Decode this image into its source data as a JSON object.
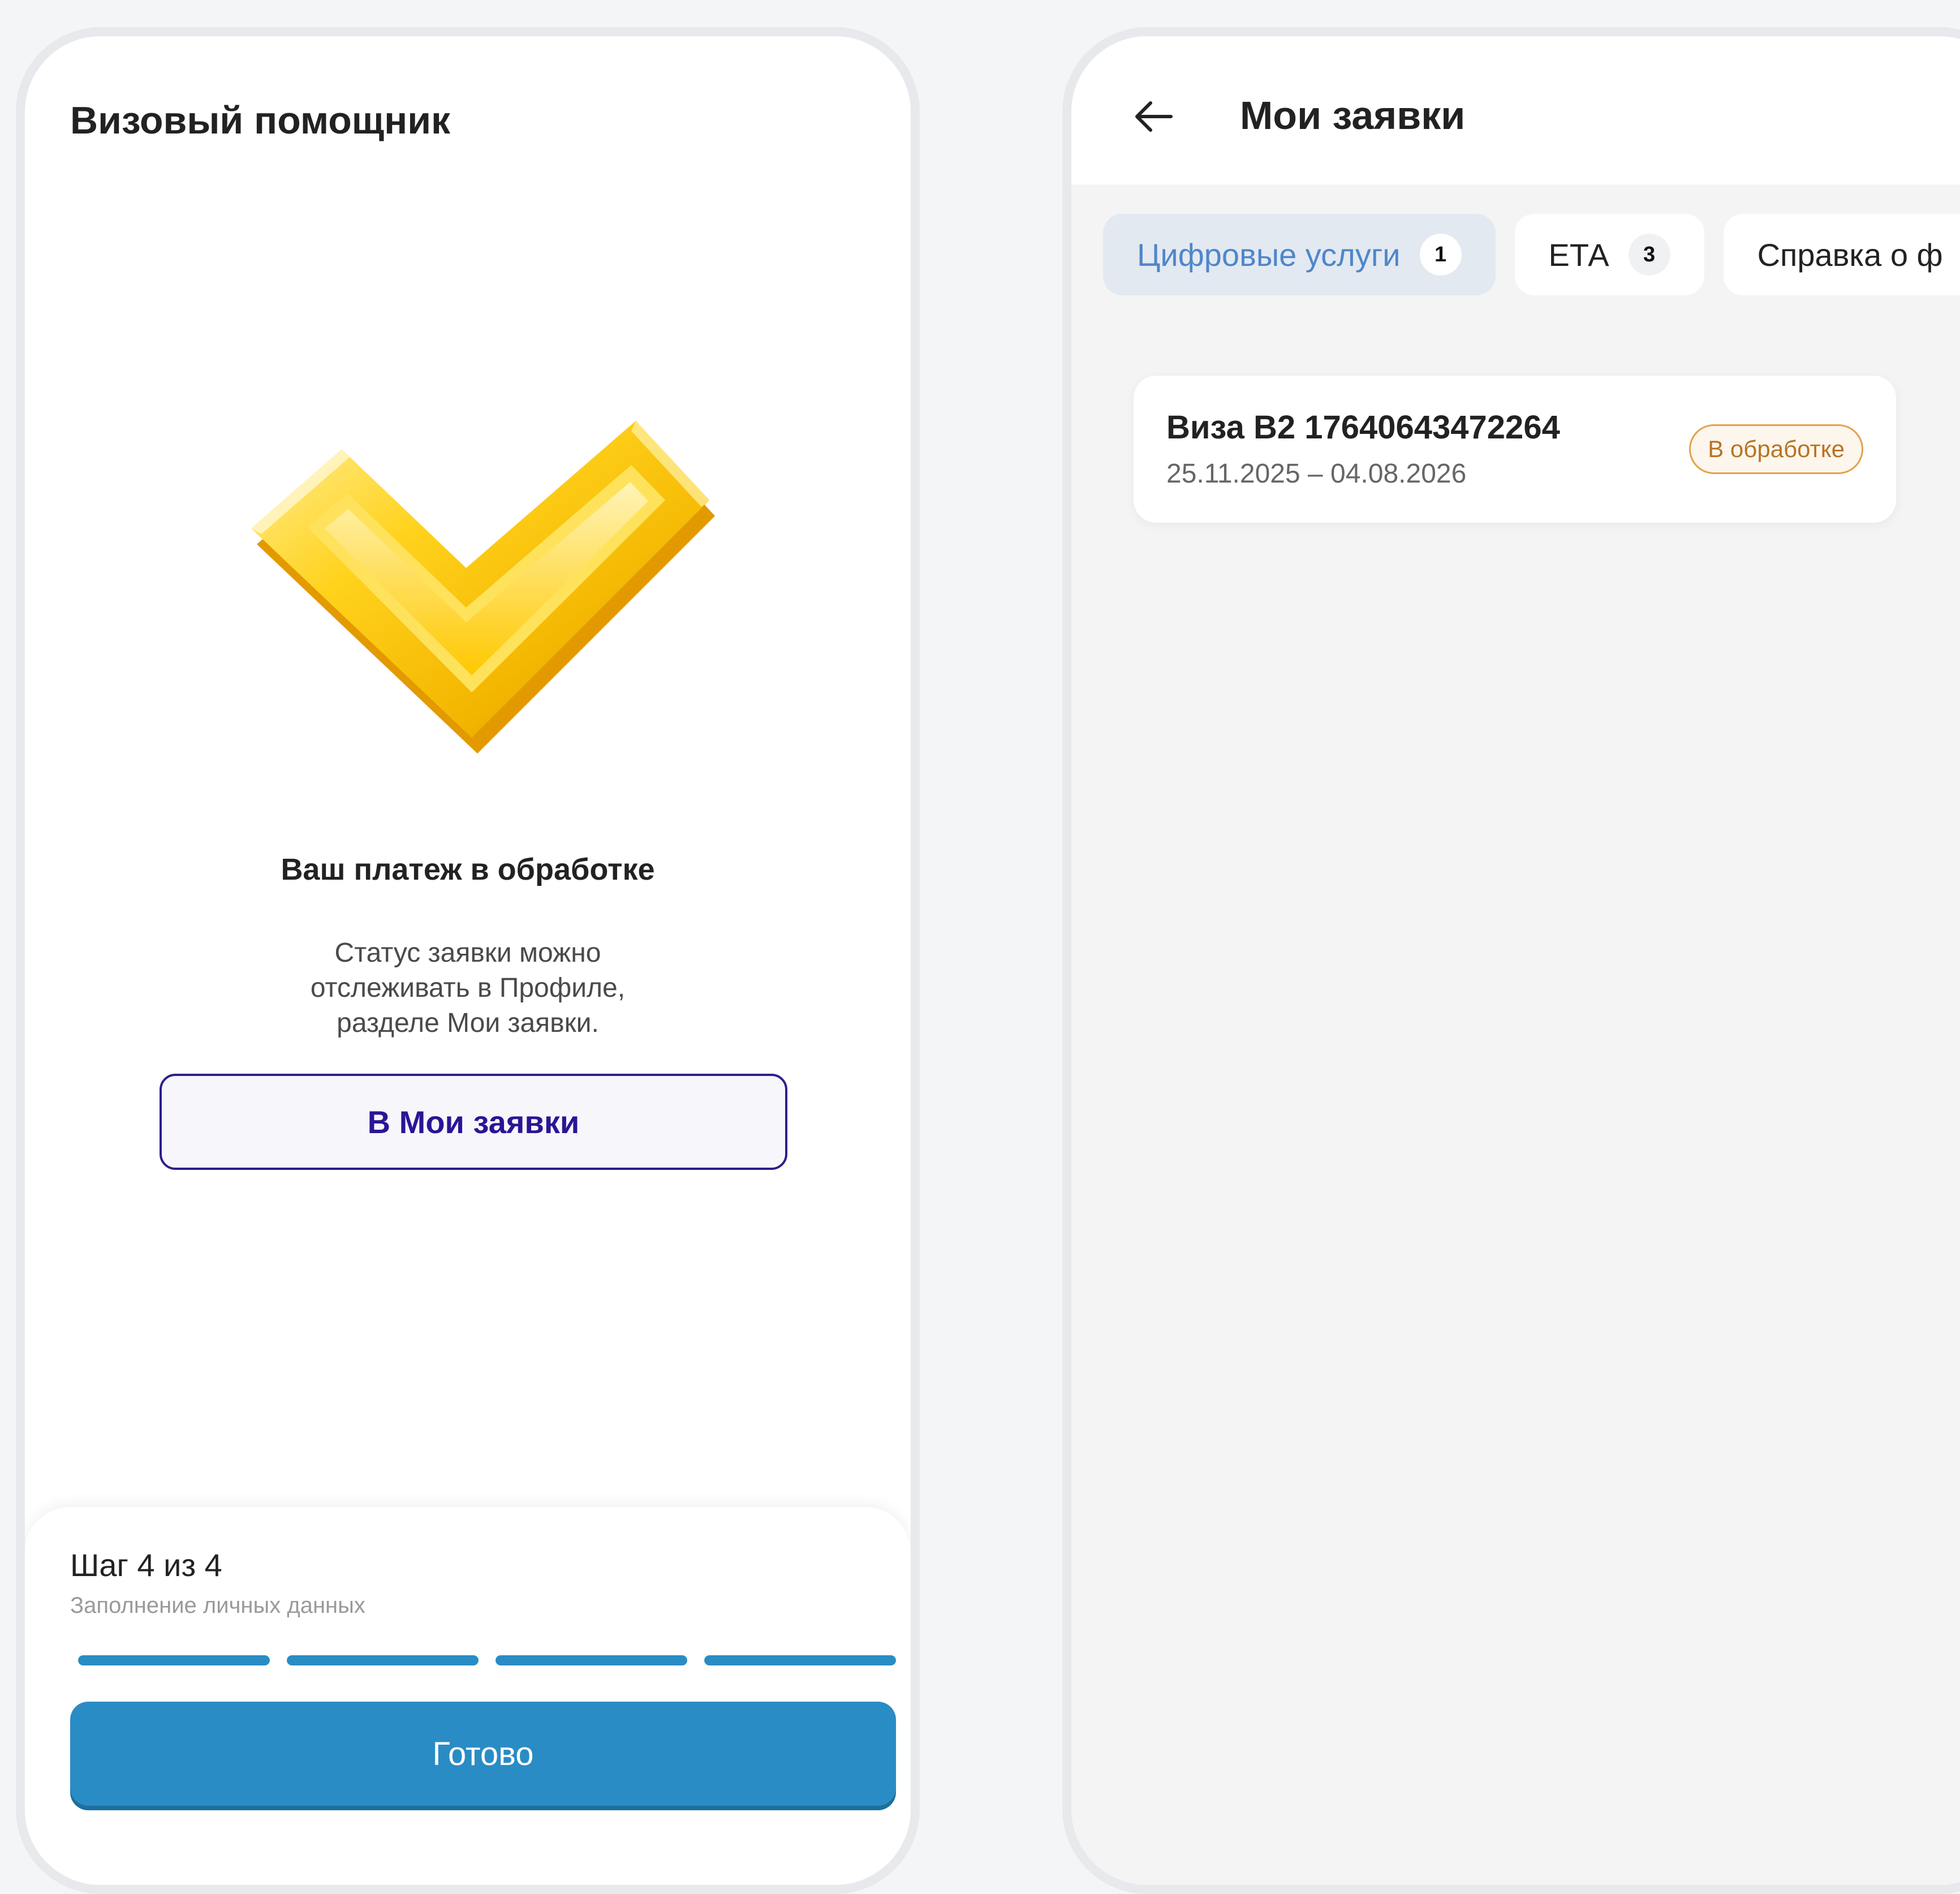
{
  "left_screen": {
    "title": "Визовый помощник",
    "status_title": "Ваш платеж в обработке",
    "status_description": [
      "Статус заявки можно",
      "отслеживать в Профиле,",
      "разделе Мои заявки."
    ],
    "my_requests_button": "В Мои заявки",
    "step": {
      "label": "Шаг 4 из 4",
      "subtitle": "Заполнение личных данных",
      "progress_segments": [
        1,
        1,
        1,
        1
      ]
    },
    "done_button": "Готово",
    "logo_icon": "gold-checkmark-icon"
  },
  "right_screen": {
    "title": "Мои заявки",
    "back_icon": "arrow-left-icon",
    "tabs": [
      {
        "label": "Цифровые услуги",
        "count": "1",
        "active": true
      },
      {
        "label": "ЕТА",
        "count": "3",
        "active": false
      },
      {
        "label": "Справка о ф",
        "count": null,
        "active": false
      }
    ],
    "request_card": {
      "title": "Виза В2 17640643472264",
      "dates": "25.11.2025 – 04.08.2026",
      "status": "В обработке"
    }
  },
  "colors": {
    "primary_blue": "#2a8cc4",
    "button_outline": "#2a1f8c",
    "status_badge": "#e2a24c",
    "active_tab_text": "#4f86c9"
  }
}
